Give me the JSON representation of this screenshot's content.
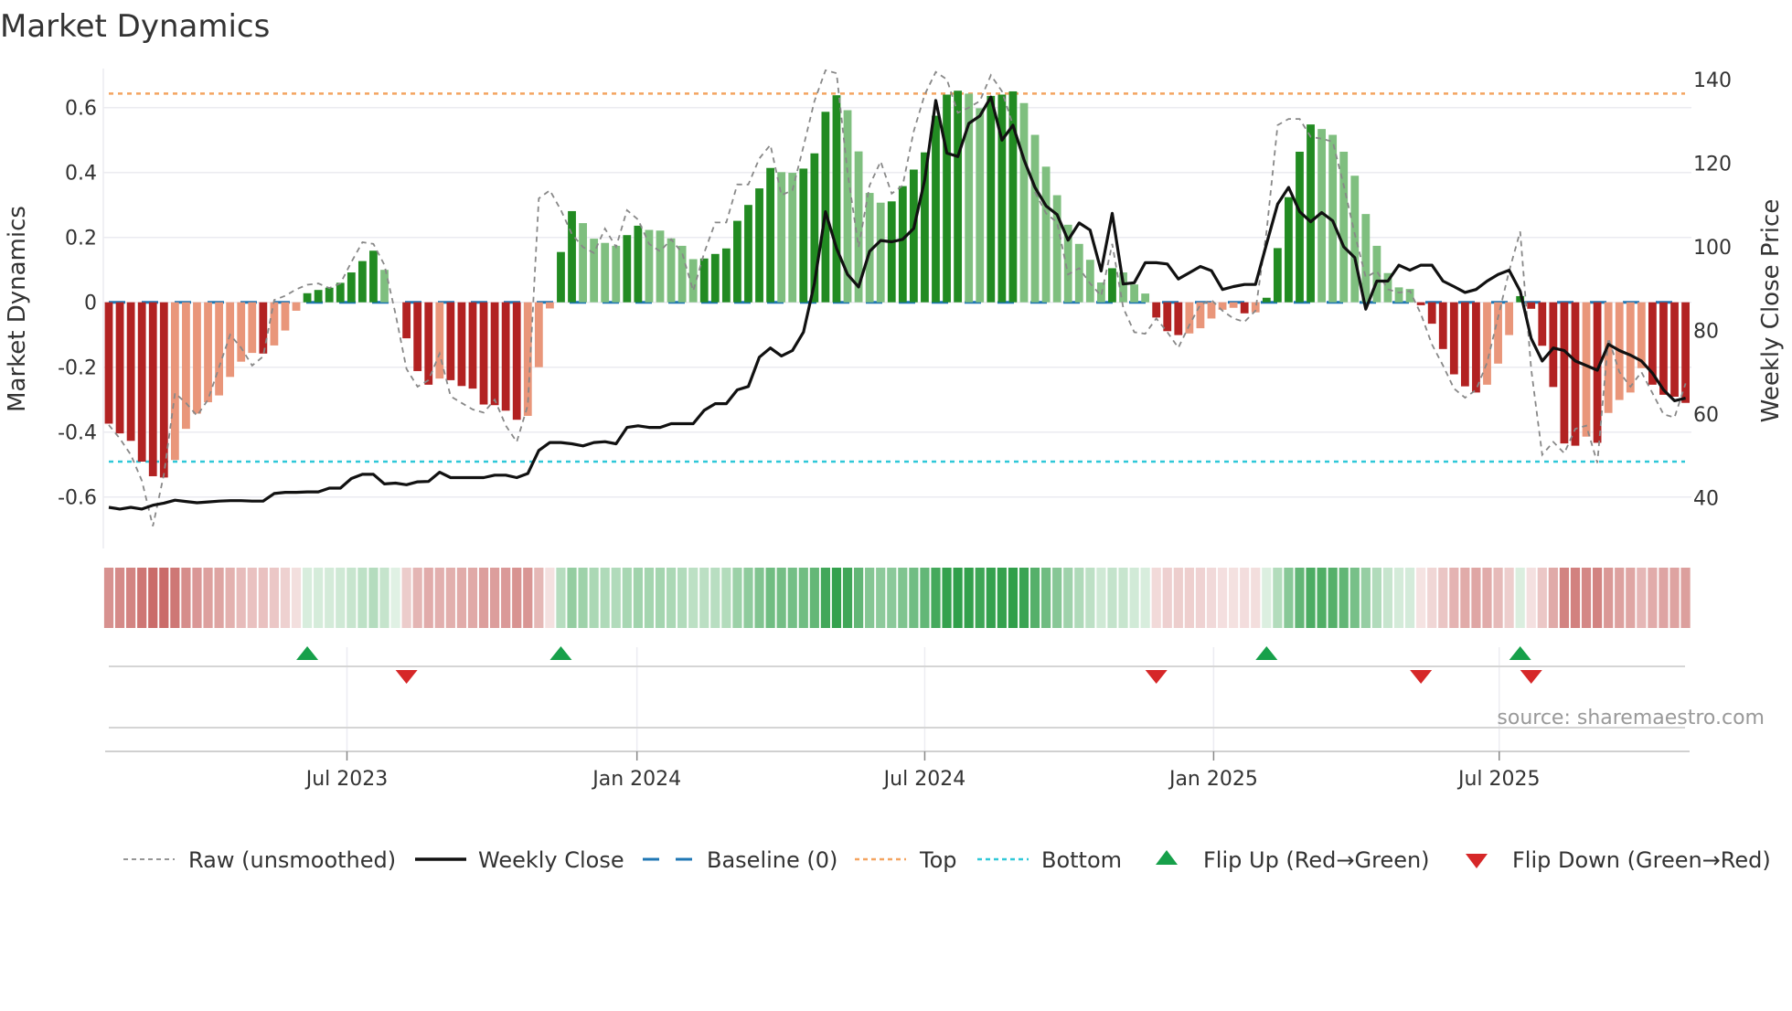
{
  "title": "Market Dynamics",
  "source": "source: sharemaestro.com",
  "chart_data": {
    "type": "bar",
    "title": "Market Dynamics",
    "ylabel": "Market Dynamics",
    "y2label": "Weekly Close Price",
    "ylim": [
      -0.76,
      0.72
    ],
    "y2lim": [
      37,
      143
    ],
    "yticks": [
      "-0.6",
      "-0.4",
      "-0.2",
      "0",
      "0.2",
      "0.4",
      "0.6"
    ],
    "yticks_values": [
      -0.6,
      -0.4,
      -0.2,
      0,
      0.2,
      0.4,
      0.6
    ],
    "y2ticks": [
      "40",
      "60",
      "80",
      "100",
      "120",
      "140"
    ],
    "y2ticks_values": [
      40,
      60,
      80,
      100,
      120,
      140
    ],
    "x_unit": "week index",
    "xticks": [
      {
        "label": "Jul 2023",
        "week": 21.6
      },
      {
        "label": "Jan 2024",
        "week": 47.9
      },
      {
        "label": "Jul 2024",
        "week": 74.0
      },
      {
        "label": "Jan 2025",
        "week": 100.2
      },
      {
        "label": "Jul 2025",
        "week": 126.1
      }
    ],
    "top": 0.643,
    "bottom": -0.491,
    "baseline": 0,
    "smoothed": [
      -0.374,
      -0.404,
      -0.427,
      -0.491,
      -0.536,
      -0.54,
      -0.486,
      -0.39,
      -0.343,
      -0.308,
      -0.287,
      -0.23,
      -0.183,
      -0.156,
      -0.158,
      -0.133,
      -0.087,
      -0.026,
      0.028,
      0.038,
      0.045,
      0.06,
      0.092,
      0.127,
      0.159,
      0.1,
      0,
      -0.111,
      -0.212,
      -0.254,
      -0.235,
      -0.24,
      -0.258,
      -0.266,
      -0.315,
      -0.317,
      -0.334,
      -0.362,
      -0.35,
      -0.2,
      -0.019,
      0.155,
      0.281,
      0.244,
      0.196,
      0.183,
      0.174,
      0.207,
      0.236,
      0.223,
      0.221,
      0.197,
      0.174,
      0.133,
      0.135,
      0.149,
      0.166,
      0.251,
      0.3,
      0.351,
      0.414,
      0.401,
      0.399,
      0.412,
      0.459,
      0.587,
      0.638,
      0.592,
      0.465,
      0.337,
      0.307,
      0.311,
      0.358,
      0.409,
      0.462,
      0.575,
      0.64,
      0.652,
      0.643,
      0.598,
      0.636,
      0.64,
      0.65,
      0.614,
      0.516,
      0.418,
      0.33,
      0.239,
      0.18,
      0.131,
      0.061,
      0.105,
      0.092,
      0.055,
      0.027,
      -0.047,
      -0.089,
      -0.101,
      -0.096,
      -0.08,
      -0.05,
      -0.023,
      -0.017,
      -0.034,
      -0.031,
      0.014,
      0.167,
      0.324,
      0.464,
      0.548,
      0.534,
      0.516,
      0.464,
      0.39,
      0.272,
      0.174,
      0.09,
      0.046,
      0.041,
      -0.009,
      -0.066,
      -0.144,
      -0.222,
      -0.259,
      -0.278,
      -0.254,
      -0.189,
      -0.101,
      0.019,
      -0.02,
      -0.134,
      -0.261,
      -0.435,
      -0.442,
      -0.414,
      -0.433,
      -0.341,
      -0.301,
      -0.278,
      -0.203,
      -0.254,
      -0.285,
      -0.291,
      -0.31
    ],
    "strengthening": [
      1,
      1,
      1,
      1,
      1,
      1,
      0,
      0,
      0,
      0,
      0,
      0,
      0,
      0,
      1,
      0,
      0,
      0,
      1,
      1,
      1,
      1,
      1,
      1,
      1,
      0,
      0,
      1,
      1,
      1,
      0,
      1,
      1,
      1,
      1,
      1,
      1,
      1,
      0,
      0,
      0,
      1,
      1,
      0,
      0,
      0,
      0,
      1,
      1,
      0,
      0,
      0,
      0,
      0,
      1,
      1,
      1,
      1,
      1,
      1,
      1,
      0,
      0,
      1,
      1,
      1,
      1,
      0,
      0,
      0,
      0,
      1,
      1,
      1,
      1,
      1,
      1,
      1,
      0,
      0,
      1,
      1,
      1,
      0,
      0,
      0,
      0,
      0,
      0,
      0,
      0,
      1,
      0,
      0,
      0,
      1,
      1,
      1,
      0,
      0,
      0,
      0,
      0,
      1,
      0,
      1,
      1,
      1,
      1,
      1,
      0,
      0,
      0,
      0,
      0,
      0,
      0,
      0,
      0,
      1,
      1,
      1,
      1,
      1,
      1,
      0,
      0,
      0,
      1,
      1,
      1,
      1,
      1,
      1,
      0,
      1,
      0,
      0,
      0,
      0,
      1,
      1,
      1,
      1
    ],
    "raw": [
      -0.378,
      -0.42,
      -0.47,
      -0.55,
      -0.69,
      -0.53,
      -0.28,
      -0.31,
      -0.35,
      -0.3,
      -0.2,
      -0.1,
      -0.14,
      -0.195,
      -0.167,
      0.007,
      0.02,
      0.04,
      0.054,
      0.058,
      0.044,
      0.058,
      0.124,
      0.185,
      0.18,
      0.115,
      -0.036,
      -0.205,
      -0.26,
      -0.24,
      -0.158,
      -0.29,
      -0.31,
      -0.33,
      -0.34,
      -0.3,
      -0.38,
      -0.43,
      -0.317,
      0.32,
      0.345,
      0.284,
      0.21,
      0.17,
      0.152,
      0.227,
      0.17,
      0.284,
      0.255,
      0.18,
      0.157,
      0.194,
      0.152,
      0.035,
      0.152,
      0.246,
      0.246,
      0.363,
      0.363,
      0.443,
      0.485,
      0.33,
      0.345,
      0.48,
      0.62,
      0.715,
      0.706,
      0.4,
      0.17,
      0.36,
      0.434,
      0.335,
      0.36,
      0.527,
      0.64,
      0.71,
      0.687,
      0.584,
      0.6,
      0.62,
      0.7,
      0.65,
      0.546,
      0.45,
      0.34,
      0.274,
      0.246,
      0.086,
      0.105,
      0.058,
      0.02,
      0.18,
      -0.017,
      -0.092,
      -0.097,
      -0.05,
      -0.092,
      -0.14,
      -0.07,
      -0.007,
      0.007,
      -0.026,
      -0.05,
      -0.06,
      -0.026,
      0.218,
      0.546,
      0.565,
      0.565,
      0.51,
      0.504,
      0.495,
      0.36,
      0.21,
      0.077,
      0.096,
      0.04,
      0.03,
      0.035,
      -0.036,
      -0.13,
      -0.195,
      -0.266,
      -0.294,
      -0.27,
      -0.186,
      -0.045,
      0.096,
      0.218,
      -0.205,
      -0.47,
      -0.43,
      -0.465,
      -0.39,
      -0.38,
      -0.495,
      -0.11,
      -0.215,
      -0.26,
      -0.215,
      -0.28,
      -0.345,
      -0.355,
      -0.25
    ],
    "weekly_close": [
      37.7,
      37.3,
      37.7,
      37.3,
      38.2,
      38.7,
      39.4,
      39.1,
      38.8,
      39.0,
      39.2,
      39.3,
      39.3,
      39.2,
      39.2,
      41.0,
      41.3,
      41.3,
      41.4,
      41.4,
      42.3,
      42.3,
      44.6,
      45.6,
      45.6,
      43.3,
      43.5,
      43.1,
      43.8,
      43.9,
      46.1,
      44.8,
      44.8,
      44.8,
      44.8,
      45.4,
      45.4,
      44.8,
      45.8,
      51.3,
      53.2,
      53.2,
      52.9,
      52.4,
      53.2,
      53.4,
      52.9,
      56.8,
      57.2,
      56.8,
      56.8,
      57.7,
      57.7,
      57.7,
      60.9,
      62.5,
      62.5,
      65.8,
      66.6,
      73.6,
      75.8,
      73.9,
      75.2,
      79.6,
      91.3,
      108.4,
      99.6,
      93.4,
      90.4,
      98.9,
      101.5,
      101.2,
      101.8,
      104.4,
      116.0,
      135.0,
      122.4,
      121.6,
      129.5,
      131.3,
      135.8,
      125.5,
      129.1,
      120.8,
      114.2,
      109.8,
      107.7,
      101.6,
      105.7,
      104.0,
      94.2,
      108.0,
      91.1,
      91.4,
      96.2,
      96.2,
      95.9,
      92.3,
      93.8,
      95.3,
      94.3,
      89.8,
      90.5,
      91.0,
      91.0,
      100.7,
      110.2,
      114.2,
      108.4,
      106.0,
      108.2,
      106.2,
      100.0,
      97.4,
      85.1,
      91.8,
      91.8,
      95.6,
      94.4,
      95.6,
      95.6,
      91.8,
      90.5,
      89.1,
      89.8,
      91.8,
      93.4,
      94.4,
      89.4,
      78.1,
      72.7,
      75.8,
      75.2,
      72.7,
      71.6,
      70.5,
      76.7,
      75.2,
      74.1,
      72.7,
      69.8,
      65.8,
      63.2,
      63.8
    ],
    "flip_up_weeks": [
      18,
      41,
      105,
      128
    ],
    "flip_down_weeks": [
      27,
      95,
      119,
      129
    ],
    "legend": {
      "placement": "bottom",
      "items": [
        "Raw (unsmoothed)",
        "Weekly Close",
        "Baseline (0)",
        "Top",
        "Bottom",
        "Flip Up (Red→Green)",
        "Flip Down (Green→Red)"
      ]
    },
    "colors": {
      "pos_strong": "#228b22",
      "pos_weak": "#7fbf7f",
      "neg_strong": "#b22222",
      "neg_weak": "#e9967a",
      "close": "#111111",
      "raw": "#888888",
      "baseline": "#1f77b4",
      "top": "#f4a460",
      "bottom": "#30c8d8",
      "flip_up": "#17a04a",
      "flip_down": "#d62728",
      "strip_pos": "#2e9e48",
      "strip_neg": "#c0504d"
    }
  }
}
